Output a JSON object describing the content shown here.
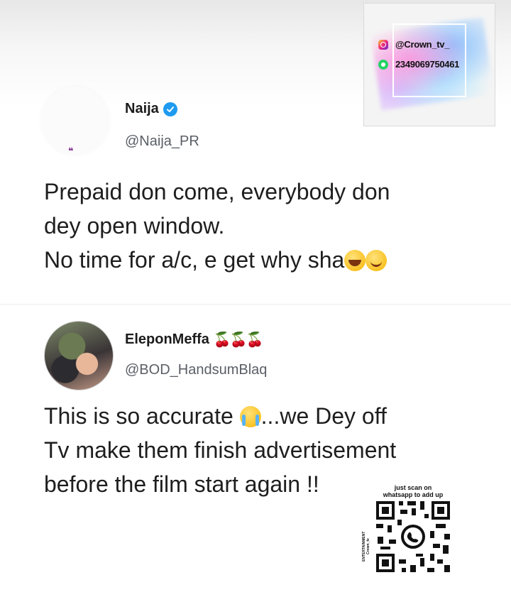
{
  "watermark": {
    "instagram_handle": "@Crown_tv_",
    "whatsapp_number": "2349069750461",
    "icons": [
      "instagram-icon",
      "whatsapp-icon"
    ]
  },
  "tweets": [
    {
      "display_name": "Naija",
      "verified": true,
      "handle": "@Naija_PR",
      "avatar_mark": "❝",
      "text": "Prepaid don come, everybody don\ndey open window.\nNo time for a/c, e get why sha",
      "trailing_emojis": [
        "laugh-icon",
        "smile-icon"
      ]
    },
    {
      "display_name": "EleponMeffa",
      "name_emojis": "🍒🍒🍒",
      "handle": "@BOD_HandsumBlaq",
      "text_before_emoji": "This is so accurate ",
      "text_after_emoji": "...we Dey off\nTv make them finish advertisement\nbefore the film start again !!",
      "inline_emoji": "cry-icon"
    }
  ],
  "qr": {
    "caption": "just scan on\nwhatsapp to add up",
    "side_label": "ENTERTAINMENT\nCrown_tv",
    "center_icon": "whatsapp-icon"
  },
  "colors": {
    "verified": "#1d9bf0",
    "whatsapp": "#25d366",
    "text": "#1e1e1e",
    "handle": "#5a5f66"
  }
}
